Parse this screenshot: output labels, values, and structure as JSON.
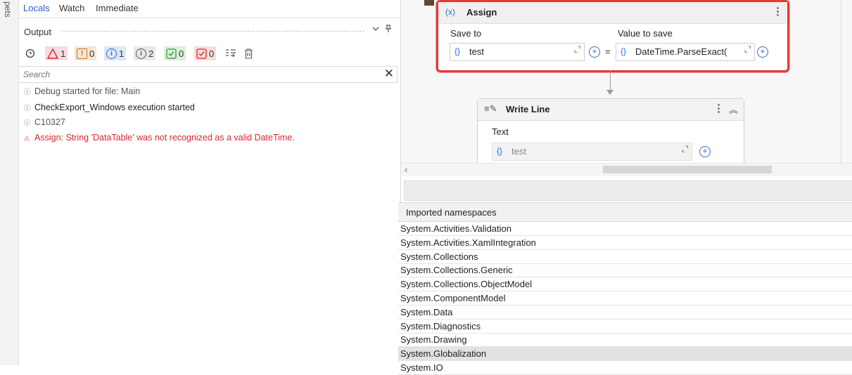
{
  "side_strip": {
    "label": "pets"
  },
  "tabs": [
    {
      "label": "Locals",
      "active": true
    },
    {
      "label": "Watch",
      "active": false
    },
    {
      "label": "Immediate",
      "active": false
    }
  ],
  "output": {
    "title": "Output",
    "header_icons": [
      "chevron-down-icon",
      "pin-icon"
    ],
    "filters": [
      {
        "name": "errors",
        "icon": "warning-triangle-icon",
        "count": "1",
        "color": "#d9262f"
      },
      {
        "name": "warnings",
        "icon": "warning-box-icon",
        "count": "0",
        "color": "#c8741e"
      },
      {
        "name": "info",
        "icon": "info-circle-icon",
        "count": "1",
        "color": "#2b6bd6"
      },
      {
        "name": "trace",
        "icon": "trace-circle-icon",
        "count": "2",
        "color": "#555555"
      },
      {
        "name": "success",
        "icon": "check-box-icon",
        "count": "0",
        "color": "#2f9a3d"
      },
      {
        "name": "failed-checks",
        "icon": "check-box-icon",
        "count": "0",
        "color": "#d9262f"
      }
    ],
    "search_placeholder": "Search",
    "log": [
      {
        "icon": "trace-icon",
        "text": "Debug started for file: Main",
        "color": "#555555"
      },
      {
        "icon": "info-icon",
        "text": "CheckExport_Windows execution started",
        "color": "#222222"
      },
      {
        "icon": "trace-icon",
        "text": "C10327",
        "color": "#555555"
      },
      {
        "icon": "warning-icon",
        "text": "Assign: String 'DataTable' was not recognized as a valid DateTime.",
        "color": "#d9262f"
      }
    ]
  },
  "assign": {
    "badge": "(x)",
    "title": "Assign",
    "save_to_label": "Save to",
    "value_label": "Value to save",
    "save_to_value": "test",
    "value": "DateTime.ParseExact(c",
    "brace": "{}",
    "equals": "="
  },
  "write_line": {
    "title": "Write Line",
    "text_label": "Text",
    "text_value": "test",
    "brace": "{}"
  },
  "namespaces": {
    "header": "Imported namespaces",
    "items": [
      "System.Activities.Validation",
      "System.Activities.XamlIntegration",
      "System.Collections",
      "System.Collections.Generic",
      "System.Collections.ObjectModel",
      "System.ComponentModel",
      "System.Data",
      "System.Diagnostics",
      "System.Drawing",
      "System.Globalization",
      "System.IO"
    ],
    "selected": "System.Globalization"
  }
}
